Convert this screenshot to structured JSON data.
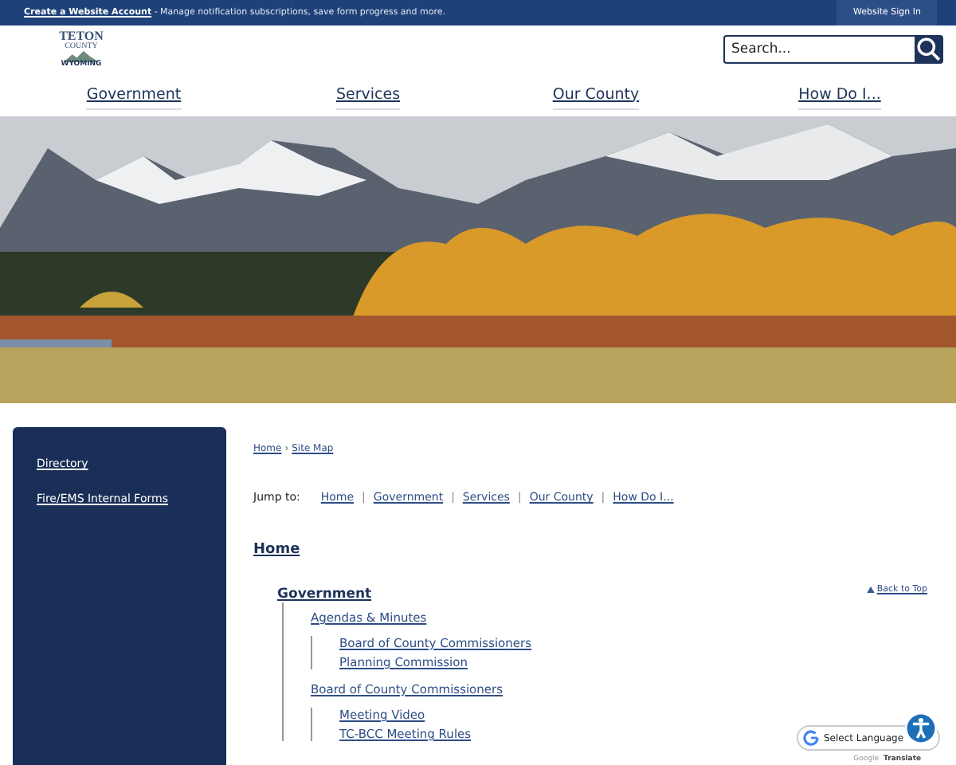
{
  "top_bar": {
    "account_link": "Create a Website Account",
    "account_text": " - Manage notification subscriptions, save form progress and more.",
    "sign_in": "Website Sign In"
  },
  "logo": {
    "lines": [
      "TETON",
      "COUNTY",
      "WYOMING"
    ]
  },
  "search": {
    "placeholder": "Search..."
  },
  "nav": [
    {
      "label": "Government"
    },
    {
      "label": "Services"
    },
    {
      "label": "Our County"
    },
    {
      "label": "How Do I..."
    }
  ],
  "sidebar": {
    "items": [
      {
        "label": "Directory"
      },
      {
        "label": "Fire/EMS Internal Forms"
      }
    ]
  },
  "breadcrumb": {
    "separator": "›",
    "links": [
      "Home",
      "Site Map"
    ]
  },
  "jump_to": {
    "label": "Jump to:",
    "separator": "|",
    "links": [
      "Home",
      "Government",
      "Services",
      "Our County",
      "How Do I..."
    ]
  },
  "sitemap": {
    "home": "Home",
    "back_to_top": "Back to Top",
    "section": {
      "label": "Government",
      "children": [
        {
          "label": "Agendas & Minutes",
          "children": [
            {
              "label": "Board of County Commissioners"
            },
            {
              "label": "Planning Commission"
            }
          ]
        },
        {
          "label": "Board of County Commissioners",
          "children": [
            {
              "label": "Meeting Video"
            },
            {
              "label": "TC-BCC Meeting Rules"
            }
          ]
        }
      ]
    }
  },
  "translate": {
    "select": "Select Language",
    "powered_by": "Google",
    "translate": "Translate"
  }
}
